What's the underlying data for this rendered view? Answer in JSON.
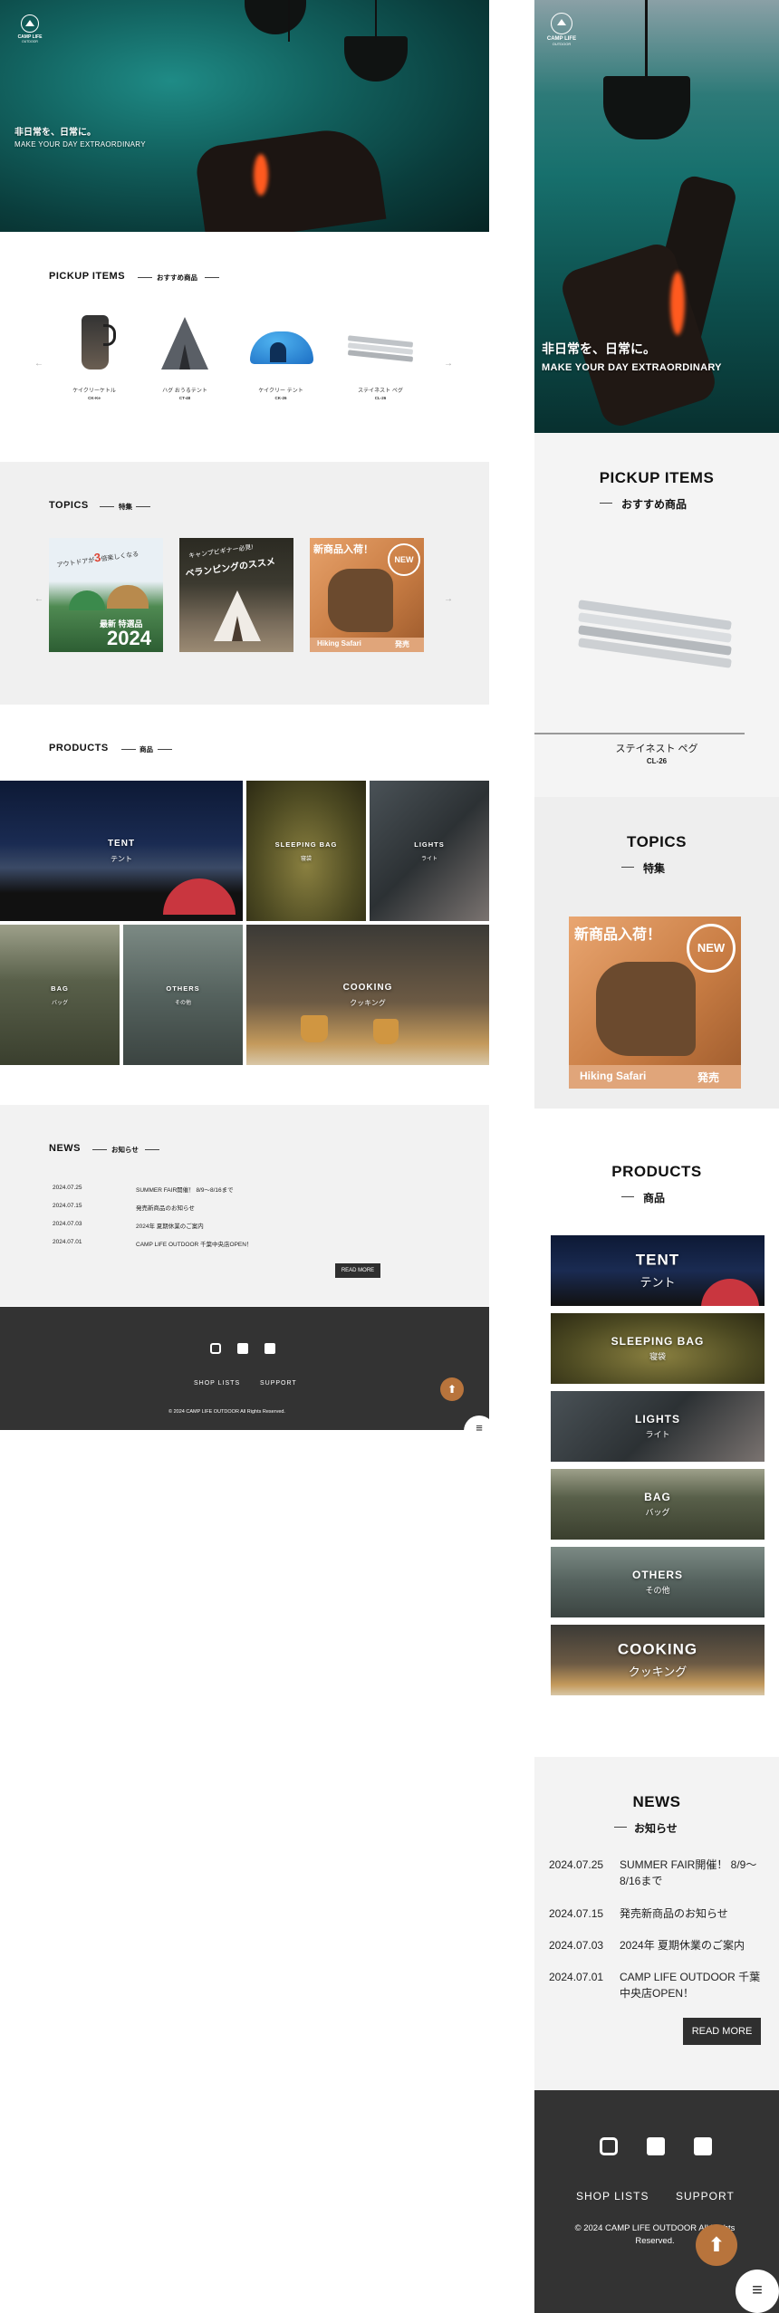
{
  "brand": {
    "name": "CAMP LIFE",
    "sub": "OUTDOOR"
  },
  "hero": {
    "tagline_jp": "非日常を、日常に。",
    "tagline_en": "MAKE YOUR DAY EXTRAORDINARY"
  },
  "pickup": {
    "title": "PICKUP ITEMS",
    "subtitle": "おすすめ商品",
    "items": [
      {
        "name": "ケイクリーケトル",
        "code": "CK-Ke"
      },
      {
        "name": "ハグ おうるテント",
        "code": "CT-48"
      },
      {
        "name": "ケイクリー テント",
        "code": "CK-26"
      },
      {
        "name": "ステイネスト ペグ",
        "code": "CL-26"
      }
    ],
    "mobile_item": {
      "name": "ステイネスト ペグ",
      "code": "CL-26"
    }
  },
  "topics": {
    "title": "TOPICS",
    "subtitle": "特集",
    "cards": [
      {
        "line1": "アウトドアが",
        "highlight": "3",
        "line2": "倍楽しくなる",
        "line3": "最新 特選品",
        "year": "2024"
      },
      {
        "line1": "キャンプビギナー必見!",
        "line2": "ベランピングのススメ"
      },
      {
        "line1": "新商品入荷！",
        "badge": "NEW",
        "footer": "Hiking Safari",
        "footer2": "発売"
      }
    ]
  },
  "products": {
    "title": "PRODUCTS",
    "subtitle": "商品",
    "categories": [
      {
        "en": "TENT",
        "jp": "テント"
      },
      {
        "en": "SLEEPING BAG",
        "jp": "寝袋"
      },
      {
        "en": "LIGHTS",
        "jp": "ライト"
      },
      {
        "en": "BAG",
        "jp": "バッグ"
      },
      {
        "en": "OTHERS",
        "jp": "その他"
      },
      {
        "en": "COOKING",
        "jp": "クッキング"
      }
    ]
  },
  "news": {
    "title": "NEWS",
    "subtitle": "お知らせ",
    "items": [
      {
        "date": "2024.07.25",
        "title": "SUMMER FAIR開催！ 8/9〜8/16まで"
      },
      {
        "date": "2024.07.15",
        "title": "発売新商品のお知らせ"
      },
      {
        "date": "2024.07.03",
        "title": "2024年 夏期休業のご案内"
      },
      {
        "date": "2024.07.01",
        "title": "CAMP LIFE OUTDOOR 千葉中央店OPEN！"
      }
    ],
    "read_more": "READ MORE"
  },
  "footer": {
    "links": [
      "SHOP LISTS",
      "SUPPORT"
    ],
    "copyright": "© 2024 CAMP LIFE OUTDOOR All Rights Reserved.",
    "social": [
      "instagram-icon",
      "facebook-icon",
      "twitter-icon"
    ]
  },
  "ui": {
    "menu_glyph": "≡",
    "to_top_glyph": "⬆",
    "arrow_prev": "←",
    "arrow_next": "→"
  },
  "colors": {
    "accent": "#b8743c",
    "footer_bg": "#333333",
    "section_gray": "#f0f0f0",
    "teal": "#17706d"
  }
}
